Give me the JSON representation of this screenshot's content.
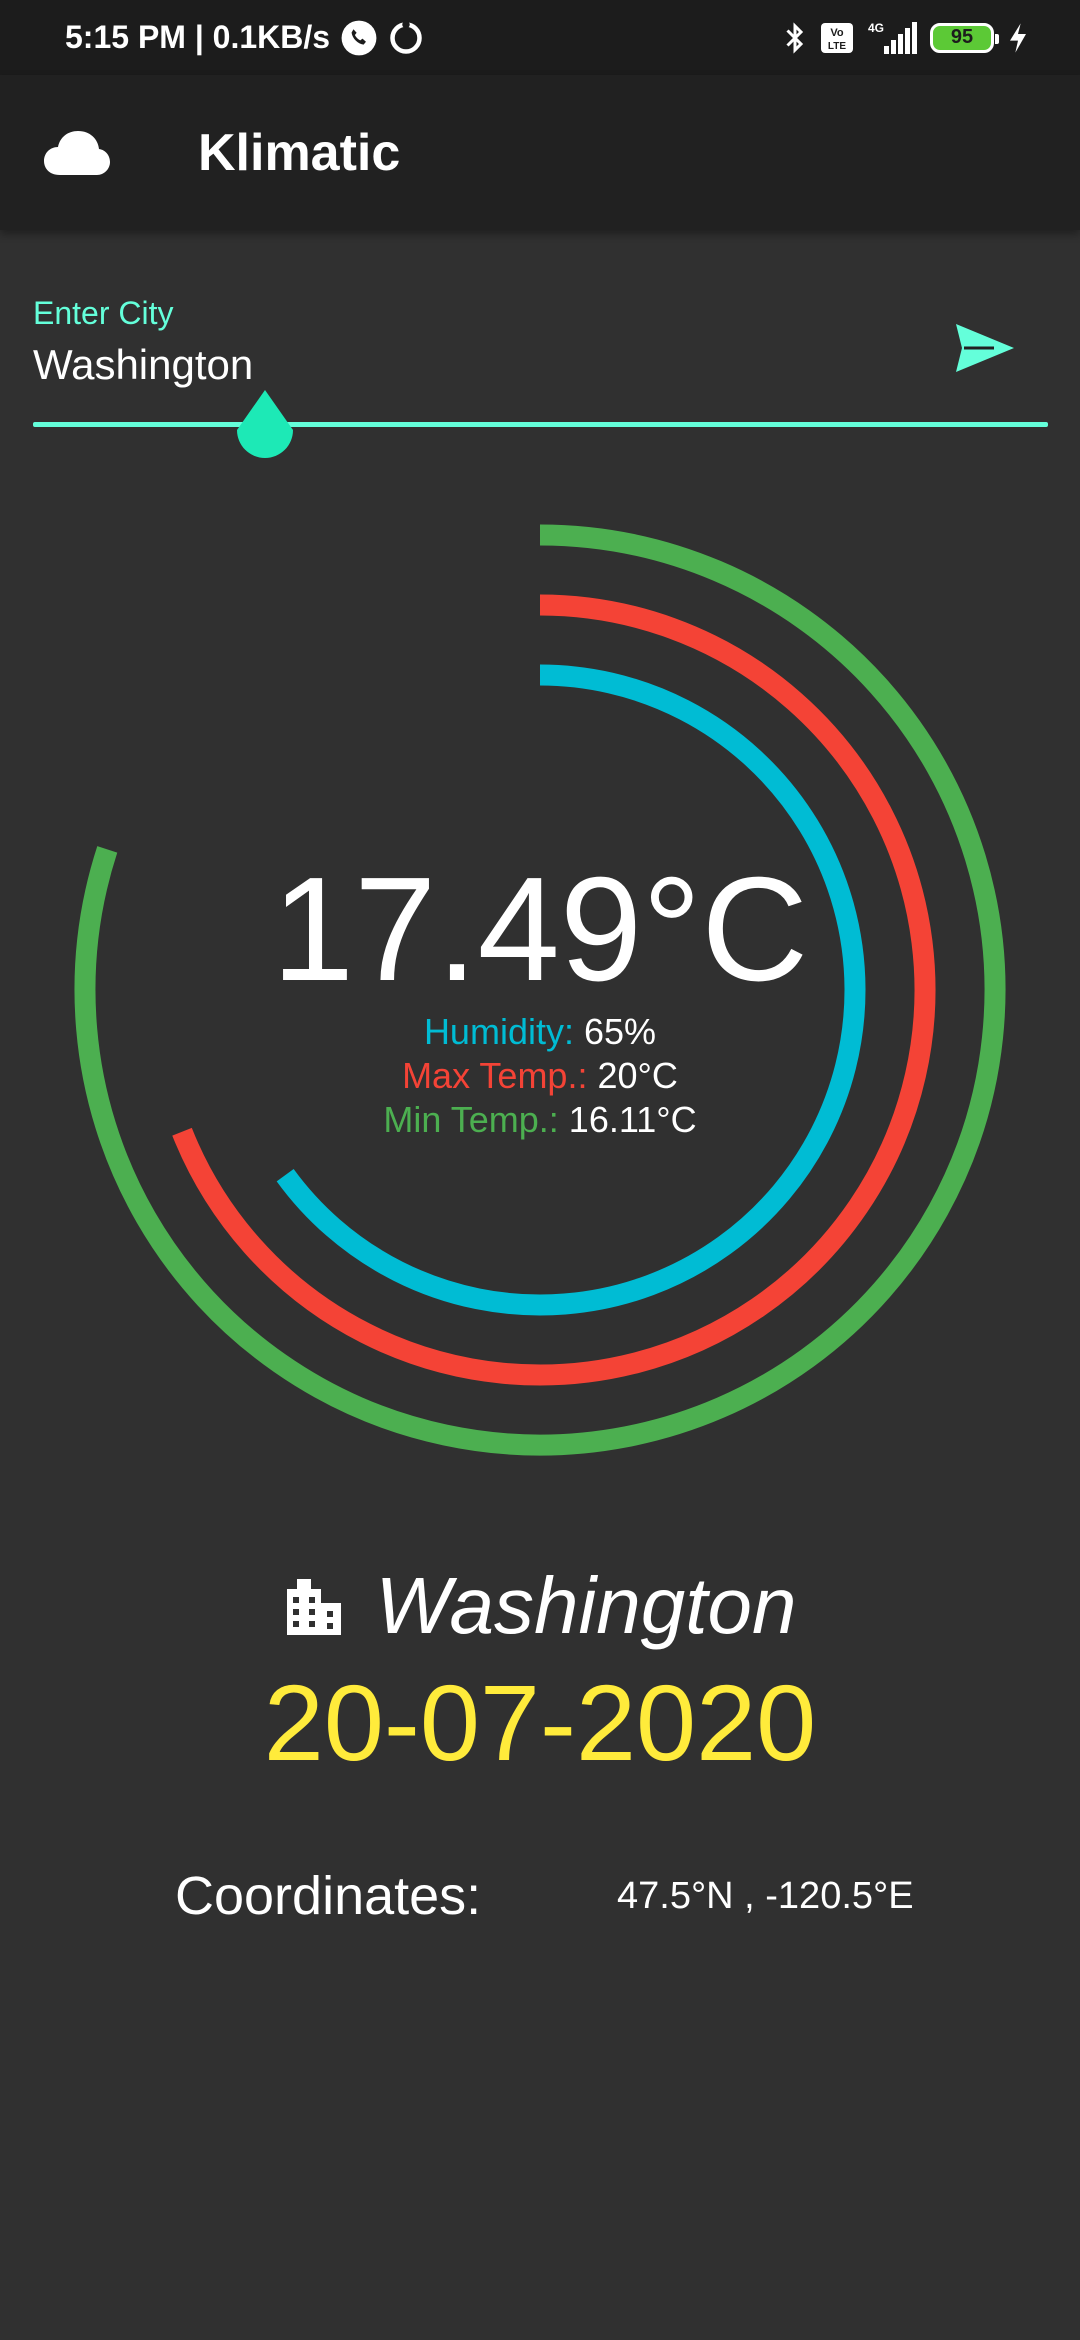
{
  "status_bar": {
    "time_speed": "5:15 PM | 0.1KB/s",
    "network_label": "4G",
    "volte_label": "Vo LTE",
    "battery": "95"
  },
  "app_bar": {
    "title": "Klimatic",
    "icon": "cloud-icon"
  },
  "search": {
    "label": "Enter City",
    "value": "Washington",
    "send_icon": "send-icon"
  },
  "weather": {
    "temperature": "17.49°C",
    "humidity_label": "Humidity:",
    "humidity_value": "65%",
    "max_label": "Max Temp.:",
    "max_value": "20°C",
    "min_label": "Min Temp.:",
    "min_value": "16.11°C",
    "humidity_fraction": 0.65,
    "max_fraction": 0.69,
    "min_fraction": 0.8
  },
  "location": {
    "city": "Washington",
    "date": "20-07-2020",
    "coords_label": "Coordinates:",
    "coords_value": "47.5°N , -120.5°E"
  },
  "colors": {
    "accent": "#64ffda",
    "humidity": "#00bcd4",
    "max_temp": "#f44336",
    "min_temp": "#4caf50",
    "date": "#ffeb3b",
    "background": "#303030",
    "app_bar": "#212121"
  }
}
